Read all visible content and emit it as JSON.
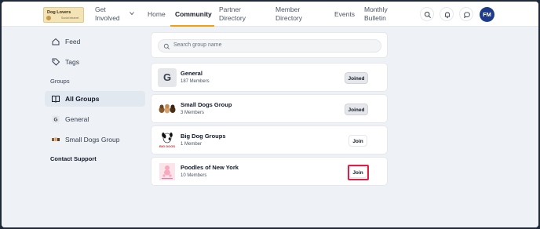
{
  "header": {
    "logo_text": "Dog Lovers",
    "logo_subtext": "Social Intranet",
    "nav": [
      {
        "label": "Get Involved"
      },
      {
        "label": "Home"
      },
      {
        "label": "Community"
      },
      {
        "label": "Partner Directory"
      },
      {
        "label": "Member Directory"
      },
      {
        "label": "Events"
      },
      {
        "label": "Monthly Bulletin"
      }
    ],
    "avatar_initials": "FM"
  },
  "sidebar": {
    "feed_label": "Feed",
    "tags_label": "Tags",
    "groups_heading": "Groups",
    "all_groups_label": "All Groups",
    "general_label": "General",
    "small_dogs_label": "Small Dogs Group",
    "contact_support_label": "Contact Support"
  },
  "search": {
    "placeholder": "Search group name"
  },
  "groups": [
    {
      "name": "General",
      "members": "187 Members",
      "action": "Joined",
      "thumb_letter": "G"
    },
    {
      "name": "Small Dogs Group",
      "members": "3 Members",
      "action": "Joined"
    },
    {
      "name": "Big Dog Groups",
      "members": "1 Member",
      "action": "Join",
      "thumb_text": "BIG DOGS"
    },
    {
      "name": "Poodles of New York",
      "members": "10 Members",
      "action": "Join"
    }
  ],
  "colors": {
    "accent_underline": "#f59e0b",
    "avatar_bg": "#1e3a8a",
    "highlight_border": "#e11d48",
    "content_bg": "#eef1f6"
  }
}
